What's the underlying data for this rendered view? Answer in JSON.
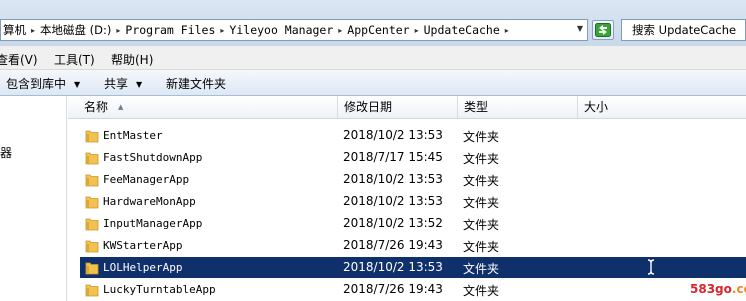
{
  "address_bar": {
    "segments": [
      "算机",
      "本地磁盘 (D:)",
      "Program Files",
      "Yileyoo Manager",
      "AppCenter",
      "UpdateCache"
    ],
    "separator_icon": "chevron-right-icon",
    "dropdown_icon": "chevron-down-icon"
  },
  "refresh": {
    "icon": "refresh-icon",
    "color": "#2e8b2e"
  },
  "search": {
    "placeholder": "搜索 UpdateCache"
  },
  "menu": {
    "items": [
      "查看(V)",
      "工具(T)",
      "帮助(H)"
    ]
  },
  "toolbar": {
    "include_label": "包含到库中",
    "share_label": "共享",
    "new_folder_label": "新建文件夹"
  },
  "nav": {
    "tail_text": "器"
  },
  "columns": {
    "name": "名称",
    "modified": "修改日期",
    "type": "类型",
    "size": "大小"
  },
  "files": [
    {
      "name": "EntMaster",
      "modified": "2018/10/2 13:53",
      "type": "文件夹",
      "selected": false
    },
    {
      "name": "FastShutdownApp",
      "modified": "2018/7/17 15:45",
      "type": "文件夹",
      "selected": false
    },
    {
      "name": "FeeManagerApp",
      "modified": "2018/10/2 13:53",
      "type": "文件夹",
      "selected": false
    },
    {
      "name": "HardwareMonApp",
      "modified": "2018/10/2 13:53",
      "type": "文件夹",
      "selected": false
    },
    {
      "name": "InputManagerApp",
      "modified": "2018/10/2 13:52",
      "type": "文件夹",
      "selected": false
    },
    {
      "name": "KWStarterApp",
      "modified": "2018/7/26 19:43",
      "type": "文件夹",
      "selected": false
    },
    {
      "name": "LOLHelperApp",
      "modified": "2018/10/2 13:53",
      "type": "文件夹",
      "selected": true
    },
    {
      "name": "LuckyTurntableApp",
      "modified": "2018/7/26 19:43",
      "type": "文件夹",
      "selected": false
    }
  ],
  "colors": {
    "selection": "#10306b",
    "folder": "#f2c14e",
    "watermark": "#d7262e"
  },
  "watermark": {
    "main": "583go",
    "suffix": ".com"
  }
}
